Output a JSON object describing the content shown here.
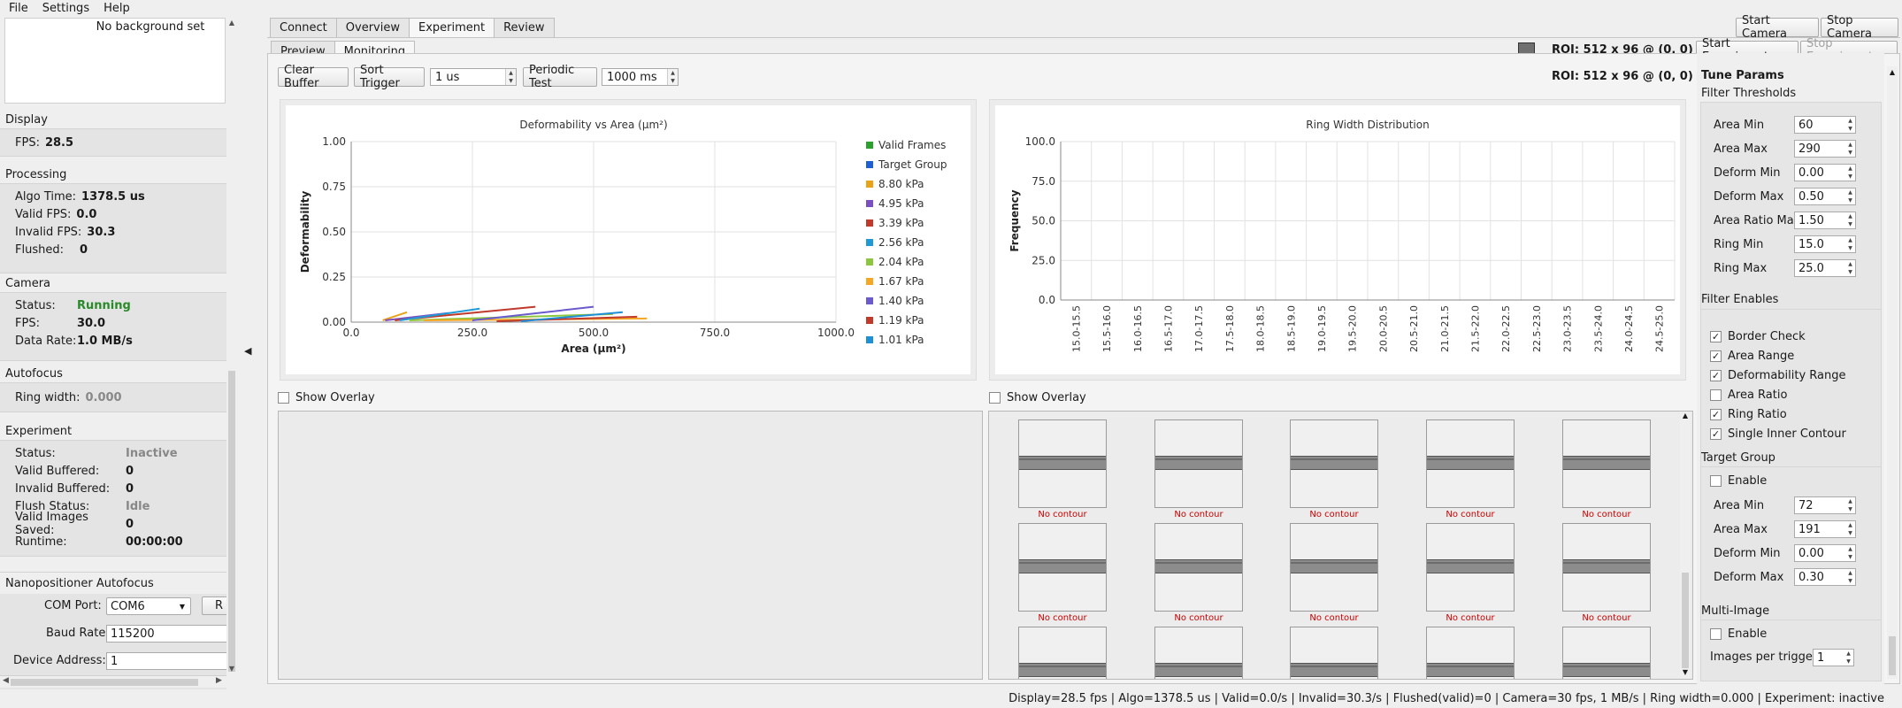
{
  "menu": [
    "File",
    "Settings",
    "Help"
  ],
  "left": {
    "background_label": "No background set",
    "display": {
      "title": "Display",
      "fps_label": "FPS:",
      "fps": "28.5"
    },
    "processing": {
      "title": "Processing",
      "rows": [
        {
          "label": "Algo Time:",
          "value": "1378.5 us"
        },
        {
          "label": "Valid FPS:",
          "value": "0.0"
        },
        {
          "label": "Invalid FPS:",
          "value": "30.3"
        },
        {
          "label": "Flushed:",
          "value": "0"
        }
      ]
    },
    "camera": {
      "title": "Camera",
      "rows": [
        {
          "label": "Status:",
          "value": "Running"
        },
        {
          "label": "FPS:",
          "value": "30.0"
        },
        {
          "label": "Data Rate:",
          "value": "1.0 MB/s"
        }
      ]
    },
    "autofocus": {
      "title": "Autofocus",
      "ring_label": "Ring width:",
      "ring_value": "0.000"
    },
    "experiment": {
      "title": "Experiment",
      "rows": [
        {
          "label": "Status:",
          "value": "Inactive"
        },
        {
          "label": "Valid Buffered:",
          "value": "0"
        },
        {
          "label": "Invalid Buffered:",
          "value": "0"
        },
        {
          "label": "Flush Status:",
          "value": "Idle"
        },
        {
          "label": "Valid Images Saved:",
          "value": "0"
        },
        {
          "label": "Runtime:",
          "value": "00:00:00"
        }
      ]
    },
    "nano": {
      "title": "Nanopositioner Autofocus",
      "com_label": "COM Port:",
      "com_value": "COM6",
      "r_btn": "R",
      "baud_label": "Baud Rate:",
      "baud_value": "115200",
      "addr_label": "Device Address:",
      "addr_value": "1"
    }
  },
  "tabs_top": [
    "Connect",
    "Overview",
    "Experiment",
    "Review"
  ],
  "tabs_sub": [
    "Preview",
    "Monitoring"
  ],
  "buttons": {
    "start_camera": "Start Camera",
    "stop_camera": "Stop Camera",
    "start_experiment": "Start Experiment",
    "stop_experiment": "Stop Experiment"
  },
  "roi": "ROI: 512 x 96 @ (0, 0)",
  "toolbar": {
    "clear_buffer": "Clear Buffer",
    "sort_trigger": "Sort Trigger",
    "trigger_value": "1 us",
    "periodic_test": "Periodic Test",
    "periodic_value": "1000 ms"
  },
  "colors": {
    "valid": "#2ca02c",
    "target": "#1f5fd6",
    "k880": "#e8a317",
    "k495": "#7b4fc4",
    "k339": "#c0392b",
    "k256": "#1f9ad6",
    "k204": "#8dc63f",
    "k167": "#f5a623",
    "k140": "#6a5acd",
    "k119": "#c0392b",
    "k101": "#1f8fd6"
  },
  "chart_data": [
    {
      "type": "line",
      "title": "Deformability vs Area (µm²)",
      "xlabel": "Area (µm²)",
      "ylabel": "Deformability",
      "xlim": [
        0,
        1000
      ],
      "ylim": [
        0,
        1
      ],
      "xticks": [
        "0.0",
        "250.0",
        "500.0",
        "750.0",
        "1000.0"
      ],
      "yticks": [
        "0.00",
        "0.25",
        "0.50",
        "0.75",
        "1.00"
      ],
      "grid": true,
      "legend": "right",
      "legend_items": [
        "Valid Frames",
        "Target Group",
        "8.80 kPa",
        "4.95 kPa",
        "3.39 kPa",
        "2.56 kPa",
        "2.04 kPa",
        "1.67 kPa",
        "1.40 kPa",
        "1.19 kPa",
        "1.01 kPa"
      ],
      "series": [
        {
          "name": "8.80 kPa",
          "color": "#e8a317",
          "x": [
            65,
            115
          ],
          "y": [
            0.01,
            0.055
          ]
        },
        {
          "name": "4.95 kPa",
          "color": "#7b4fc4",
          "x": [
            70,
            200
          ],
          "y": [
            0.01,
            0.05
          ]
        },
        {
          "name": "3.39 kPa",
          "color": "#c0392b",
          "x": [
            90,
            380
          ],
          "y": [
            0.01,
            0.085
          ]
        },
        {
          "name": "2.56 kPa",
          "color": "#1f9ad6",
          "x": [
            100,
            265
          ],
          "y": [
            0.01,
            0.075
          ]
        },
        {
          "name": "2.04 kPa",
          "color": "#8dc63f",
          "x": [
            120,
            540
          ],
          "y": [
            0.01,
            0.045
          ]
        },
        {
          "name": "1.67 kPa",
          "color": "#f5a623",
          "x": [
            150,
            610
          ],
          "y": [
            0.01,
            0.02
          ]
        },
        {
          "name": "1.40 kPa",
          "color": "#6a5acd",
          "x": [
            250,
            500
          ],
          "y": [
            0.01,
            0.085
          ]
        },
        {
          "name": "1.19 kPa",
          "color": "#c0392b",
          "x": [
            300,
            590
          ],
          "y": [
            0.005,
            0.03
          ]
        },
        {
          "name": "1.01 kPa",
          "color": "#1f8fd6",
          "x": [
            350,
            560
          ],
          "y": [
            0.005,
            0.055
          ]
        }
      ]
    },
    {
      "type": "bar",
      "title": "Ring Width Distribution",
      "xlabel": "",
      "ylabel": "Frequency",
      "ylim": [
        0,
        100
      ],
      "yticks": [
        "0.0",
        "25.0",
        "50.0",
        "75.0",
        "100.0"
      ],
      "categories": [
        "15.0-15.5",
        "15.5-16.0",
        "16.0-16.5",
        "16.5-17.0",
        "17.0-17.5",
        "17.5-18.0",
        "18.0-18.5",
        "18.5-19.0",
        "19.0-19.5",
        "19.5-20.0",
        "20.0-20.5",
        "20.5-21.0",
        "21.0-21.5",
        "21.5-22.0",
        "22.0-22.5",
        "22.5-23.0",
        "23.0-23.5",
        "23.5-24.0",
        "24.0-24.5",
        "24.5-25.0"
      ],
      "values": [
        0,
        0,
        0,
        0,
        0,
        0,
        0,
        0,
        0,
        0,
        0,
        0,
        0,
        0,
        0,
        0,
        0,
        0,
        0,
        0
      ]
    }
  ],
  "overlay_label": "Show Overlay",
  "no_contour": "No contour",
  "tune": {
    "title": "Tune Params",
    "filter_thresholds": "Filter Thresholds",
    "thresholds": [
      {
        "label": "Area Min",
        "value": "60"
      },
      {
        "label": "Area Max",
        "value": "290"
      },
      {
        "label": "Deform Min",
        "value": "0.00"
      },
      {
        "label": "Deform Max",
        "value": "0.50"
      },
      {
        "label": "Area Ratio Max",
        "value": "1.50"
      },
      {
        "label": "Ring Min",
        "value": "15.0"
      },
      {
        "label": "Ring Max",
        "value": "25.0"
      }
    ],
    "filter_enables": "Filter Enables",
    "enables": [
      {
        "label": "Border Check",
        "checked": true
      },
      {
        "label": "Area Range",
        "checked": true
      },
      {
        "label": "Deformability Range",
        "checked": true
      },
      {
        "label": "Area Ratio",
        "checked": false
      },
      {
        "label": "Ring Ratio",
        "checked": true
      },
      {
        "label": "Single Inner Contour",
        "checked": true
      }
    ],
    "target_group": "Target Group",
    "tg_enable": "Enable",
    "tg": [
      {
        "label": "Area Min",
        "value": "72"
      },
      {
        "label": "Area Max",
        "value": "191"
      },
      {
        "label": "Deform Min",
        "value": "0.00"
      },
      {
        "label": "Deform Max",
        "value": "0.30"
      }
    ],
    "multi_image": "Multi-Image",
    "mi_enable": "Enable",
    "mi_label": "Images per trigger",
    "mi_value": "1"
  },
  "status": "Display=28.5 fps | Algo=1378.5 us | Valid=0.0/s | Invalid=30.3/s | Flushed(valid)=0 | Camera=30 fps, 1 MB/s | Ring width=0.000 | Experiment: inactive"
}
